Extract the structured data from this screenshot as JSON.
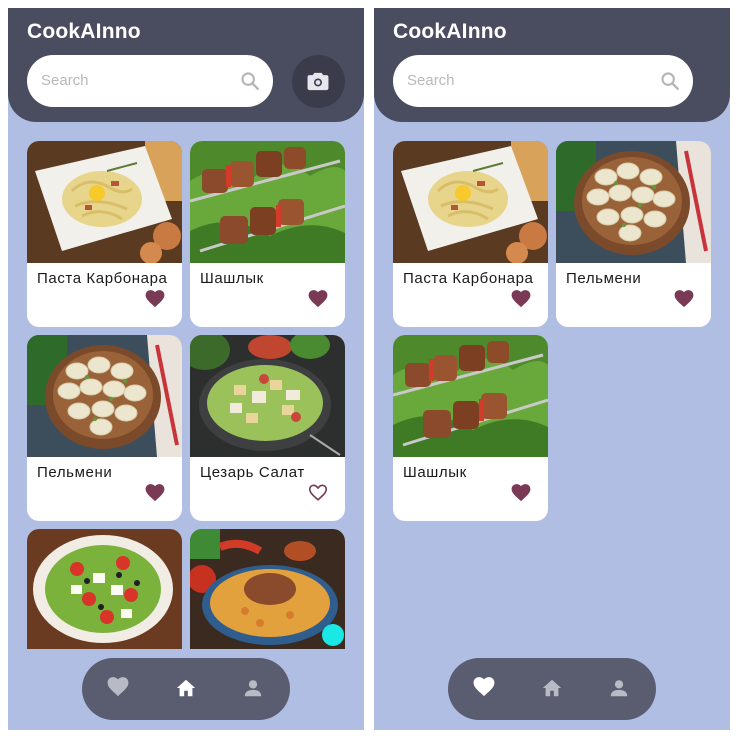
{
  "app": {
    "title": "CookAInno"
  },
  "search": {
    "placeholder": "Search"
  },
  "icons": {
    "search": "search-icon",
    "camera": "camera-icon",
    "heart": "heart-icon",
    "home": "home-icon",
    "profile": "person-icon"
  },
  "colors": {
    "header": "#4a4d5f",
    "background": "#b1bee3",
    "nav": "#5a5d6f",
    "heart": "#7a3a55",
    "nav_active": "#ffffff",
    "nav_inactive": "#b8bac6"
  },
  "left_screen": {
    "active_tab": "home",
    "recipes": [
      {
        "name": "Паста Карбонара",
        "favorite": true
      },
      {
        "name": "Шашлык",
        "favorite": true
      },
      {
        "name": "Пельмени",
        "favorite": true
      },
      {
        "name": "Цезарь Салат",
        "favorite": false
      },
      {
        "name": "",
        "favorite": null
      },
      {
        "name": "",
        "favorite": null
      }
    ]
  },
  "right_screen": {
    "active_tab": "favorites",
    "recipes": [
      {
        "name": "Паста Карбонара",
        "favorite": true
      },
      {
        "name": "Пельмени",
        "favorite": true
      },
      {
        "name": "Шашлык",
        "favorite": true
      }
    ]
  },
  "nav": {
    "items": [
      {
        "id": "favorites",
        "icon": "heart-icon"
      },
      {
        "id": "home",
        "icon": "home-icon"
      },
      {
        "id": "profile",
        "icon": "person-icon"
      }
    ]
  }
}
